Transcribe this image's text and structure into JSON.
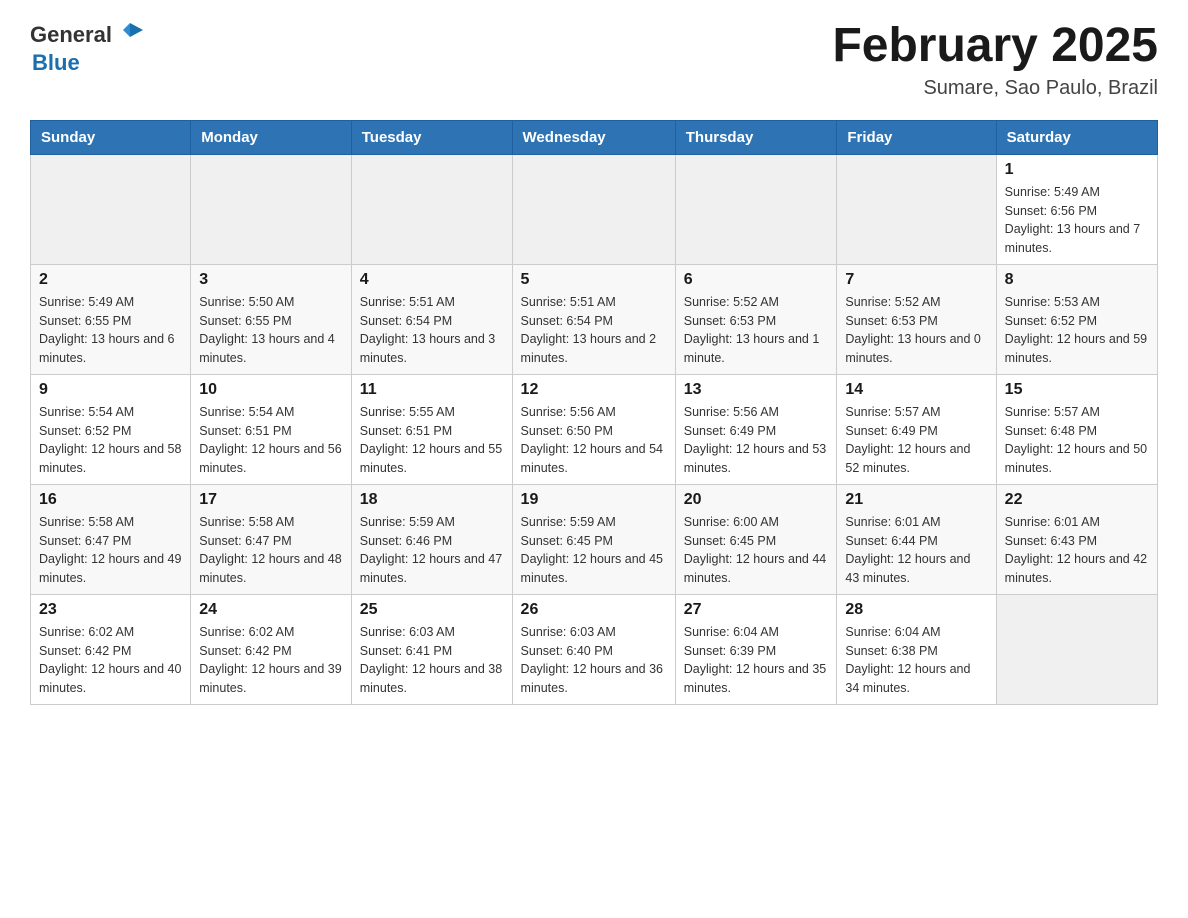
{
  "header": {
    "logo": {
      "general": "General",
      "blue": "Blue",
      "arrow_color": "#1a6faf"
    },
    "title": "February 2025",
    "location": "Sumare, Sao Paulo, Brazil"
  },
  "weekdays": [
    "Sunday",
    "Monday",
    "Tuesday",
    "Wednesday",
    "Thursday",
    "Friday",
    "Saturday"
  ],
  "weeks": [
    [
      {
        "day": "",
        "sunrise": "",
        "sunset": "",
        "daylight": ""
      },
      {
        "day": "",
        "sunrise": "",
        "sunset": "",
        "daylight": ""
      },
      {
        "day": "",
        "sunrise": "",
        "sunset": "",
        "daylight": ""
      },
      {
        "day": "",
        "sunrise": "",
        "sunset": "",
        "daylight": ""
      },
      {
        "day": "",
        "sunrise": "",
        "sunset": "",
        "daylight": ""
      },
      {
        "day": "",
        "sunrise": "",
        "sunset": "",
        "daylight": ""
      },
      {
        "day": "1",
        "sunrise": "Sunrise: 5:49 AM",
        "sunset": "Sunset: 6:56 PM",
        "daylight": "Daylight: 13 hours and 7 minutes."
      }
    ],
    [
      {
        "day": "2",
        "sunrise": "Sunrise: 5:49 AM",
        "sunset": "Sunset: 6:55 PM",
        "daylight": "Daylight: 13 hours and 6 minutes."
      },
      {
        "day": "3",
        "sunrise": "Sunrise: 5:50 AM",
        "sunset": "Sunset: 6:55 PM",
        "daylight": "Daylight: 13 hours and 4 minutes."
      },
      {
        "day": "4",
        "sunrise": "Sunrise: 5:51 AM",
        "sunset": "Sunset: 6:54 PM",
        "daylight": "Daylight: 13 hours and 3 minutes."
      },
      {
        "day": "5",
        "sunrise": "Sunrise: 5:51 AM",
        "sunset": "Sunset: 6:54 PM",
        "daylight": "Daylight: 13 hours and 2 minutes."
      },
      {
        "day": "6",
        "sunrise": "Sunrise: 5:52 AM",
        "sunset": "Sunset: 6:53 PM",
        "daylight": "Daylight: 13 hours and 1 minute."
      },
      {
        "day": "7",
        "sunrise": "Sunrise: 5:52 AM",
        "sunset": "Sunset: 6:53 PM",
        "daylight": "Daylight: 13 hours and 0 minutes."
      },
      {
        "day": "8",
        "sunrise": "Sunrise: 5:53 AM",
        "sunset": "Sunset: 6:52 PM",
        "daylight": "Daylight: 12 hours and 59 minutes."
      }
    ],
    [
      {
        "day": "9",
        "sunrise": "Sunrise: 5:54 AM",
        "sunset": "Sunset: 6:52 PM",
        "daylight": "Daylight: 12 hours and 58 minutes."
      },
      {
        "day": "10",
        "sunrise": "Sunrise: 5:54 AM",
        "sunset": "Sunset: 6:51 PM",
        "daylight": "Daylight: 12 hours and 56 minutes."
      },
      {
        "day": "11",
        "sunrise": "Sunrise: 5:55 AM",
        "sunset": "Sunset: 6:51 PM",
        "daylight": "Daylight: 12 hours and 55 minutes."
      },
      {
        "day": "12",
        "sunrise": "Sunrise: 5:56 AM",
        "sunset": "Sunset: 6:50 PM",
        "daylight": "Daylight: 12 hours and 54 minutes."
      },
      {
        "day": "13",
        "sunrise": "Sunrise: 5:56 AM",
        "sunset": "Sunset: 6:49 PM",
        "daylight": "Daylight: 12 hours and 53 minutes."
      },
      {
        "day": "14",
        "sunrise": "Sunrise: 5:57 AM",
        "sunset": "Sunset: 6:49 PM",
        "daylight": "Daylight: 12 hours and 52 minutes."
      },
      {
        "day": "15",
        "sunrise": "Sunrise: 5:57 AM",
        "sunset": "Sunset: 6:48 PM",
        "daylight": "Daylight: 12 hours and 50 minutes."
      }
    ],
    [
      {
        "day": "16",
        "sunrise": "Sunrise: 5:58 AM",
        "sunset": "Sunset: 6:47 PM",
        "daylight": "Daylight: 12 hours and 49 minutes."
      },
      {
        "day": "17",
        "sunrise": "Sunrise: 5:58 AM",
        "sunset": "Sunset: 6:47 PM",
        "daylight": "Daylight: 12 hours and 48 minutes."
      },
      {
        "day": "18",
        "sunrise": "Sunrise: 5:59 AM",
        "sunset": "Sunset: 6:46 PM",
        "daylight": "Daylight: 12 hours and 47 minutes."
      },
      {
        "day": "19",
        "sunrise": "Sunrise: 5:59 AM",
        "sunset": "Sunset: 6:45 PM",
        "daylight": "Daylight: 12 hours and 45 minutes."
      },
      {
        "day": "20",
        "sunrise": "Sunrise: 6:00 AM",
        "sunset": "Sunset: 6:45 PM",
        "daylight": "Daylight: 12 hours and 44 minutes."
      },
      {
        "day": "21",
        "sunrise": "Sunrise: 6:01 AM",
        "sunset": "Sunset: 6:44 PM",
        "daylight": "Daylight: 12 hours and 43 minutes."
      },
      {
        "day": "22",
        "sunrise": "Sunrise: 6:01 AM",
        "sunset": "Sunset: 6:43 PM",
        "daylight": "Daylight: 12 hours and 42 minutes."
      }
    ],
    [
      {
        "day": "23",
        "sunrise": "Sunrise: 6:02 AM",
        "sunset": "Sunset: 6:42 PM",
        "daylight": "Daylight: 12 hours and 40 minutes."
      },
      {
        "day": "24",
        "sunrise": "Sunrise: 6:02 AM",
        "sunset": "Sunset: 6:42 PM",
        "daylight": "Daylight: 12 hours and 39 minutes."
      },
      {
        "day": "25",
        "sunrise": "Sunrise: 6:03 AM",
        "sunset": "Sunset: 6:41 PM",
        "daylight": "Daylight: 12 hours and 38 minutes."
      },
      {
        "day": "26",
        "sunrise": "Sunrise: 6:03 AM",
        "sunset": "Sunset: 6:40 PM",
        "daylight": "Daylight: 12 hours and 36 minutes."
      },
      {
        "day": "27",
        "sunrise": "Sunrise: 6:04 AM",
        "sunset": "Sunset: 6:39 PM",
        "daylight": "Daylight: 12 hours and 35 minutes."
      },
      {
        "day": "28",
        "sunrise": "Sunrise: 6:04 AM",
        "sunset": "Sunset: 6:38 PM",
        "daylight": "Daylight: 12 hours and 34 minutes."
      },
      {
        "day": "",
        "sunrise": "",
        "sunset": "",
        "daylight": ""
      }
    ]
  ]
}
